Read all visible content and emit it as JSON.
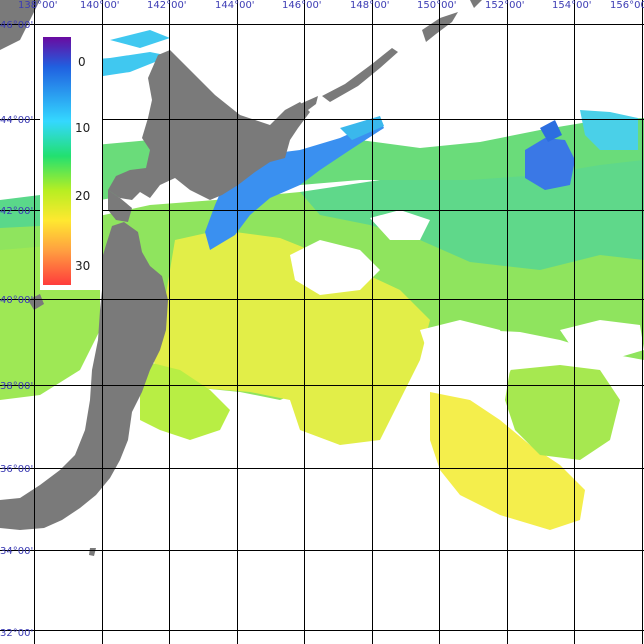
{
  "map": {
    "lon_labels": [
      "138°00'",
      "140°00'",
      "142°00'",
      "144°00'",
      "146°00'",
      "148°00'",
      "150°00'",
      "152°00'",
      "154°00'",
      "156°00'"
    ],
    "lat_labels": [
      "46°00'",
      "44°00'",
      "42°00'",
      "40°00'",
      "38°00'",
      "36°00'",
      "34°00'",
      "32°00'"
    ]
  },
  "colorbar": {
    "ticks": [
      "0",
      "10",
      "20",
      "30"
    ],
    "colors": [
      "#6a0aa0",
      "#2060e0",
      "#34d8ff",
      "#22e070",
      "#b8ee22",
      "#ffe830",
      "#ffa040",
      "#ff3c3c"
    ]
  },
  "legend_colors": {
    "land": "#7a7a7a",
    "cold": "#3a90f0",
    "cool": "#5fd88a",
    "mid": "#9ee855",
    "warm": "#e2ee48",
    "hot": "#f4ee4c",
    "grid": "#000000",
    "label": "#3c3cb4"
  }
}
